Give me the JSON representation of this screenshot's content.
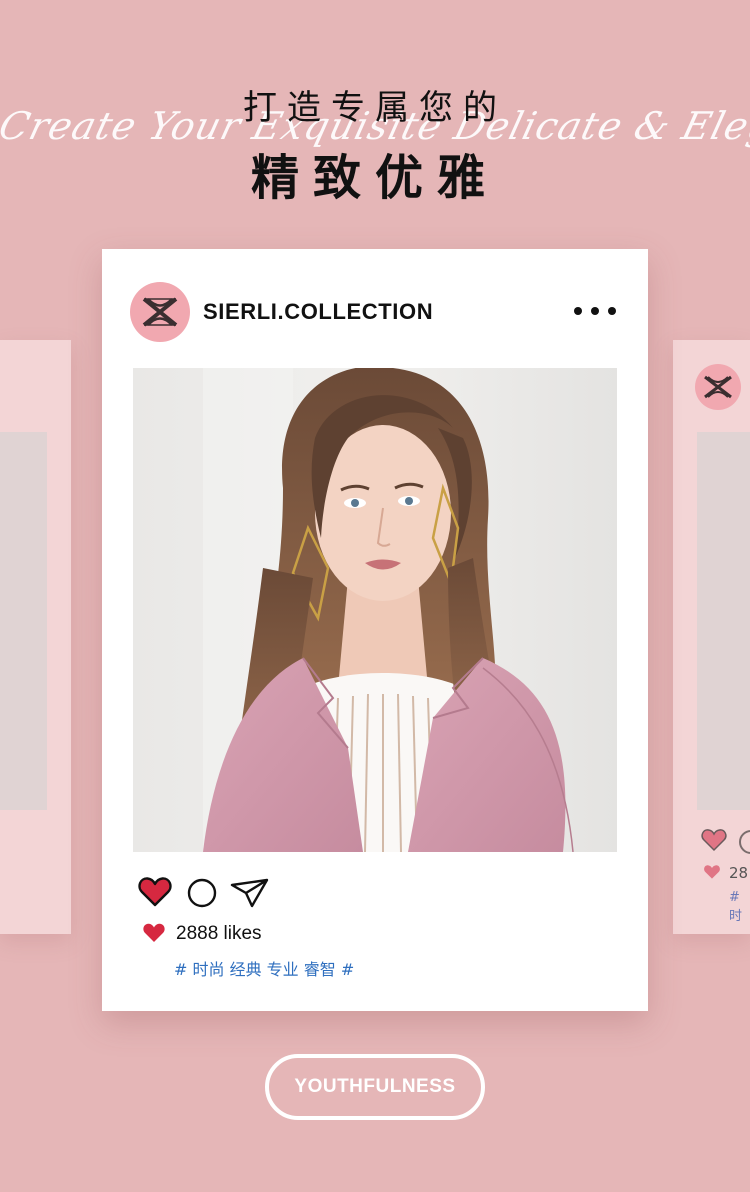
{
  "header": {
    "title_line1": "打造专属您的",
    "title_line2": "精致优雅",
    "script_text": "Create Your Exquisite Delicate & Elegance"
  },
  "post": {
    "username": "SIERLI.COLLECTION",
    "likes_text": "2888 likes",
    "tags": "# 时尚 经典 专业 睿智 #",
    "icons": [
      "heart-icon",
      "comment-icon",
      "send-icon",
      "more-icon"
    ]
  },
  "side_card": {
    "likes_partial": "28",
    "tag_partial": "# 时"
  },
  "footer": {
    "pill_label": "YOUTHFULNESS"
  },
  "colors": {
    "background": "#e5b6b7",
    "heart": "#d62840",
    "tag_blue": "#2f6fbf",
    "avatar_pink": "#f1a8b0"
  }
}
